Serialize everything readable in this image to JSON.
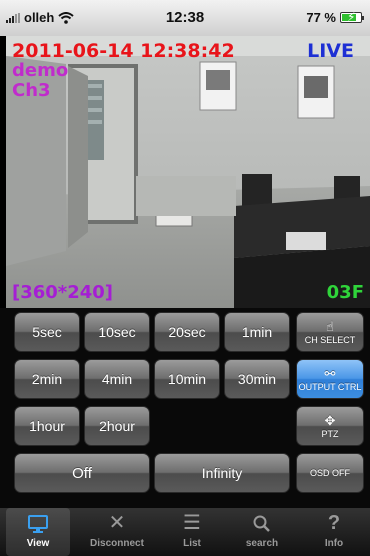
{
  "status_bar": {
    "carrier": "olleh",
    "time": "12:38",
    "battery": "77 %",
    "battery_level": 0.77
  },
  "video": {
    "datetime": "2011-06-14 12:38:42",
    "live": "LIVE",
    "name": "demo",
    "channel": "Ch3",
    "resolution": "[360*240]",
    "frame": "03F"
  },
  "controls": {
    "row1": [
      "5sec",
      "10sec",
      "20sec",
      "1min"
    ],
    "row2": [
      "2min",
      "4min",
      "10min",
      "30min"
    ],
    "row3": [
      "1hour",
      "2hour"
    ],
    "off": "Off",
    "infinity": "Infinity",
    "ch_select": "CH SELECT",
    "output_ctrl": "OUTPUT CTRL",
    "ptz": "PTZ",
    "osd_off": "OSD OFF"
  },
  "tabs": [
    "View",
    "Disconnect",
    "List",
    "search",
    "Info"
  ],
  "colors": {
    "date": "#e8141a",
    "live": "#1d2fd4",
    "name": "#c02ccc",
    "frame": "#2fd43a",
    "accent": "#3aa0f0"
  }
}
